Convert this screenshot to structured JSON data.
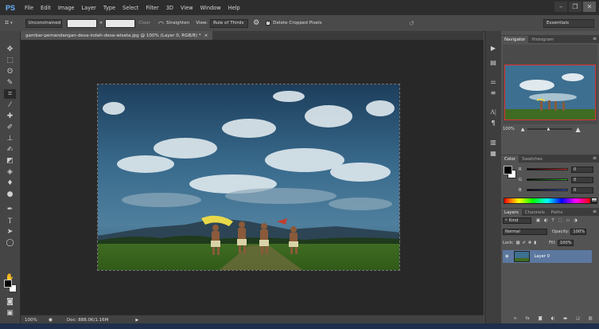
{
  "app": {
    "logo": "PS",
    "menu": [
      "File",
      "Edit",
      "Image",
      "Layer",
      "Type",
      "Select",
      "Filter",
      "3D",
      "View",
      "Window",
      "Help"
    ],
    "window_controls": {
      "minimize": "–",
      "restore": "❐",
      "close": "✕"
    }
  },
  "options_bar": {
    "ratio_value": "Unconstrained",
    "swap_symbol": "×",
    "clear_label": "Clear",
    "straighten_label": "Straighten",
    "view_label": "View:",
    "view_value": "Rule of Thirds",
    "delete_cropped_label": "Delete Cropped Pixels",
    "delete_cropped_checked": true,
    "workspace_value": "Essentials"
  },
  "document": {
    "tab_title": "gambar-pemandangan-desa-indah-desa-wisata.jpg @ 100% (Layer 0, RGB/8) *",
    "tab_close": "×"
  },
  "status": {
    "zoom": "100%",
    "doc_info": "Doc: 888.0K/1.16M"
  },
  "navigator": {
    "tabs": [
      "Navigator",
      "Histogram"
    ],
    "zoom": "100%"
  },
  "color": {
    "tabs": [
      "Color",
      "Swatches"
    ],
    "channels": [
      {
        "label": "R",
        "value": "0",
        "color": "#e03030"
      },
      {
        "label": "G",
        "value": "0",
        "color": "#30c030"
      },
      {
        "label": "B",
        "value": "0",
        "color": "#3050e0"
      }
    ],
    "foreground": "#000000",
    "background": "#ffffff"
  },
  "layers": {
    "tabs": [
      "Layers",
      "Channels",
      "Paths"
    ],
    "filter_kind": "Kind",
    "blend_mode": "Normal",
    "opacity_label": "Opacity:",
    "opacity_value": "100%",
    "lock_label": "Lock:",
    "fill_label": "Fill:",
    "fill_value": "100%",
    "items": [
      {
        "name": "Layer 0",
        "visible": true
      }
    ],
    "footer_icons": [
      "link-icon",
      "fx-icon",
      "mask-icon",
      "adjustment-icon",
      "folder-icon",
      "new-layer-icon",
      "trash-icon"
    ]
  },
  "toolbar": {
    "tools": [
      "move-tool",
      "marquee-tool",
      "lasso-tool",
      "quick-select-tool",
      "crop-tool",
      "eyedropper-tool",
      "healing-brush-tool",
      "brush-tool",
      "clone-stamp-tool",
      "history-brush-tool",
      "eraser-tool",
      "gradient-tool",
      "blur-tool",
      "dodge-tool",
      "pen-tool",
      "type-tool",
      "path-select-tool",
      "shape-tool",
      "hand-tool",
      "zoom-tool"
    ]
  }
}
